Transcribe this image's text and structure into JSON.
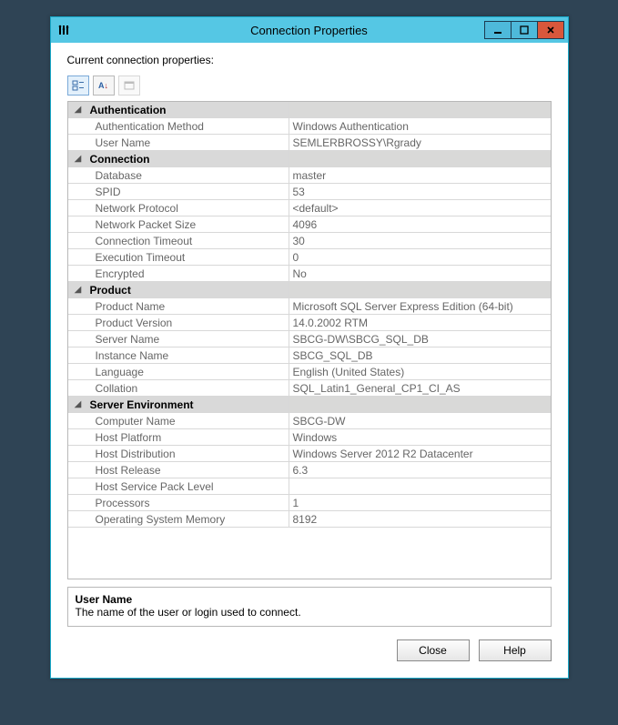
{
  "window": {
    "title": "Connection Properties"
  },
  "caption": "Current connection properties:",
  "toolbar": {
    "categorized": "⊞",
    "alphabetical": "A↓",
    "propertypages": "▭"
  },
  "categories": [
    {
      "name": "Authentication",
      "rows": [
        {
          "label": "Authentication Method",
          "value": "Windows Authentication"
        },
        {
          "label": "User Name",
          "value": "SEMLERBROSSY\\Rgrady"
        }
      ]
    },
    {
      "name": "Connection",
      "rows": [
        {
          "label": "Database",
          "value": "master"
        },
        {
          "label": "SPID",
          "value": "53"
        },
        {
          "label": "Network Protocol",
          "value": "<default>"
        },
        {
          "label": "Network Packet Size",
          "value": "4096"
        },
        {
          "label": "Connection Timeout",
          "value": "30"
        },
        {
          "label": "Execution Timeout",
          "value": "0"
        },
        {
          "label": "Encrypted",
          "value": "No"
        }
      ]
    },
    {
      "name": "Product",
      "rows": [
        {
          "label": "Product Name",
          "value": "Microsoft SQL Server Express Edition (64-bit)"
        },
        {
          "label": "Product Version",
          "value": "14.0.2002 RTM"
        },
        {
          "label": "Server Name",
          "value": "SBCG-DW\\SBCG_SQL_DB"
        },
        {
          "label": "Instance Name",
          "value": "SBCG_SQL_DB"
        },
        {
          "label": "Language",
          "value": "English (United States)"
        },
        {
          "label": "Collation",
          "value": "SQL_Latin1_General_CP1_CI_AS"
        }
      ]
    },
    {
      "name": "Server Environment",
      "rows": [
        {
          "label": "Computer Name",
          "value": "SBCG-DW"
        },
        {
          "label": "Host Platform",
          "value": "Windows"
        },
        {
          "label": "Host Distribution",
          "value": "Windows Server 2012 R2 Datacenter"
        },
        {
          "label": "Host Release",
          "value": "6.3"
        },
        {
          "label": "Host Service Pack Level",
          "value": ""
        },
        {
          "label": "Processors",
          "value": "1"
        },
        {
          "label": "Operating System Memory",
          "value": "8192"
        }
      ]
    }
  ],
  "description": {
    "title": "User Name",
    "text": "The name of the user or login used to connect."
  },
  "buttons": {
    "close": "Close",
    "help": "Help"
  }
}
